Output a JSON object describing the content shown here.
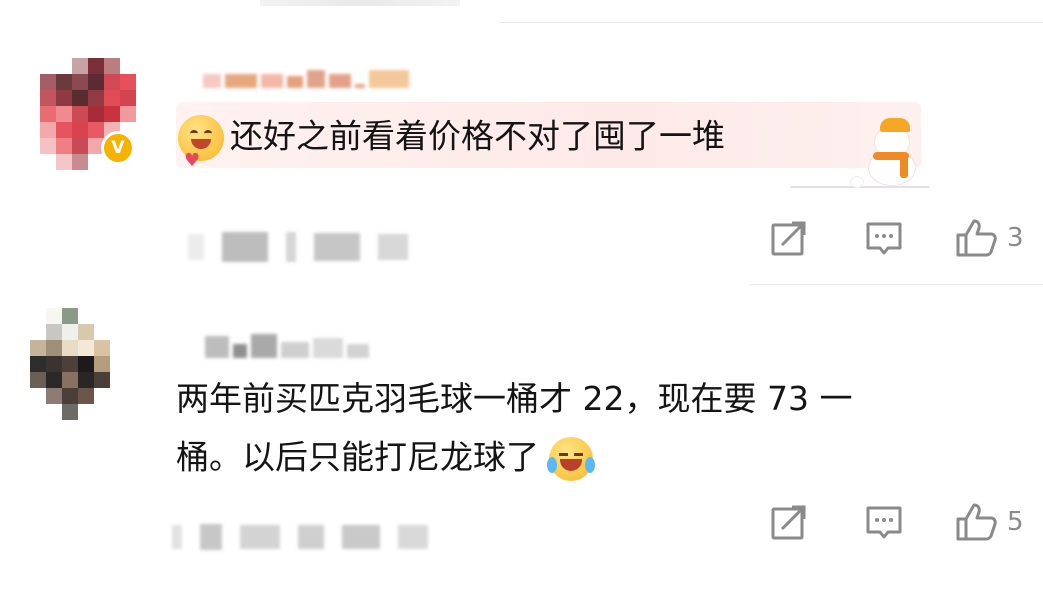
{
  "comments": [
    {
      "text_line1": "还好之前看着价格不对了囤了一堆",
      "likes": "3",
      "verified_badge": "V",
      "emoji": "hug-emoji",
      "sticker": "snowman-sticker"
    },
    {
      "text_line1": "两年前买匹克羽毛球一桶才 22，现在要 73 一",
      "text_line2": "桶。以后只能打尼龙球了",
      "likes": "5",
      "emoji": "laughing-tears-emoji"
    }
  ],
  "icons": {
    "share": "share-icon",
    "reply": "comment-icon",
    "like": "thumbs-up-icon"
  },
  "colors": {
    "text": "#141414",
    "meta": "#8a8a8a",
    "bubble": "#fde9e8",
    "badge": "#f5b300",
    "divider": "#e9e9e9"
  }
}
